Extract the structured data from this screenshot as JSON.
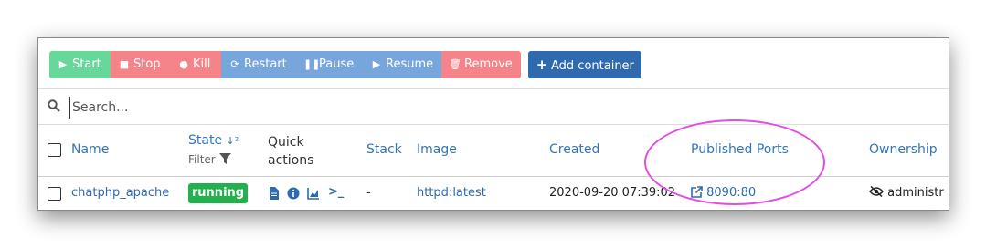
{
  "toolbar": {
    "start": "Start",
    "stop": "Stop",
    "kill": "Kill",
    "restart": "Restart",
    "pause": "Pause",
    "resume": "Resume",
    "remove": "Remove",
    "add_container": "Add container"
  },
  "search": {
    "placeholder": "Search..."
  },
  "table": {
    "headers": {
      "name": "Name",
      "state": "State",
      "state_filter": "Filter",
      "quick_actions_1": "Quick",
      "quick_actions_2": "actions",
      "stack": "Stack",
      "image": "Image",
      "created": "Created",
      "published_ports": "Published Ports",
      "ownership": "Ownership"
    },
    "rows": [
      {
        "name": "chatphp_apache",
        "state": "running",
        "stack": "-",
        "image": "httpd:latest",
        "created": "2020-09-20 07:39:02",
        "port": "8090:80",
        "ownership": "administr"
      }
    ]
  },
  "colors": {
    "start": "#68d79a",
    "danger": "#f4848a",
    "info": "#77a6dc",
    "primary": "#2f6aaf",
    "running": "#23b14d",
    "link": "#3275b8",
    "annotation": "#e24de4"
  }
}
